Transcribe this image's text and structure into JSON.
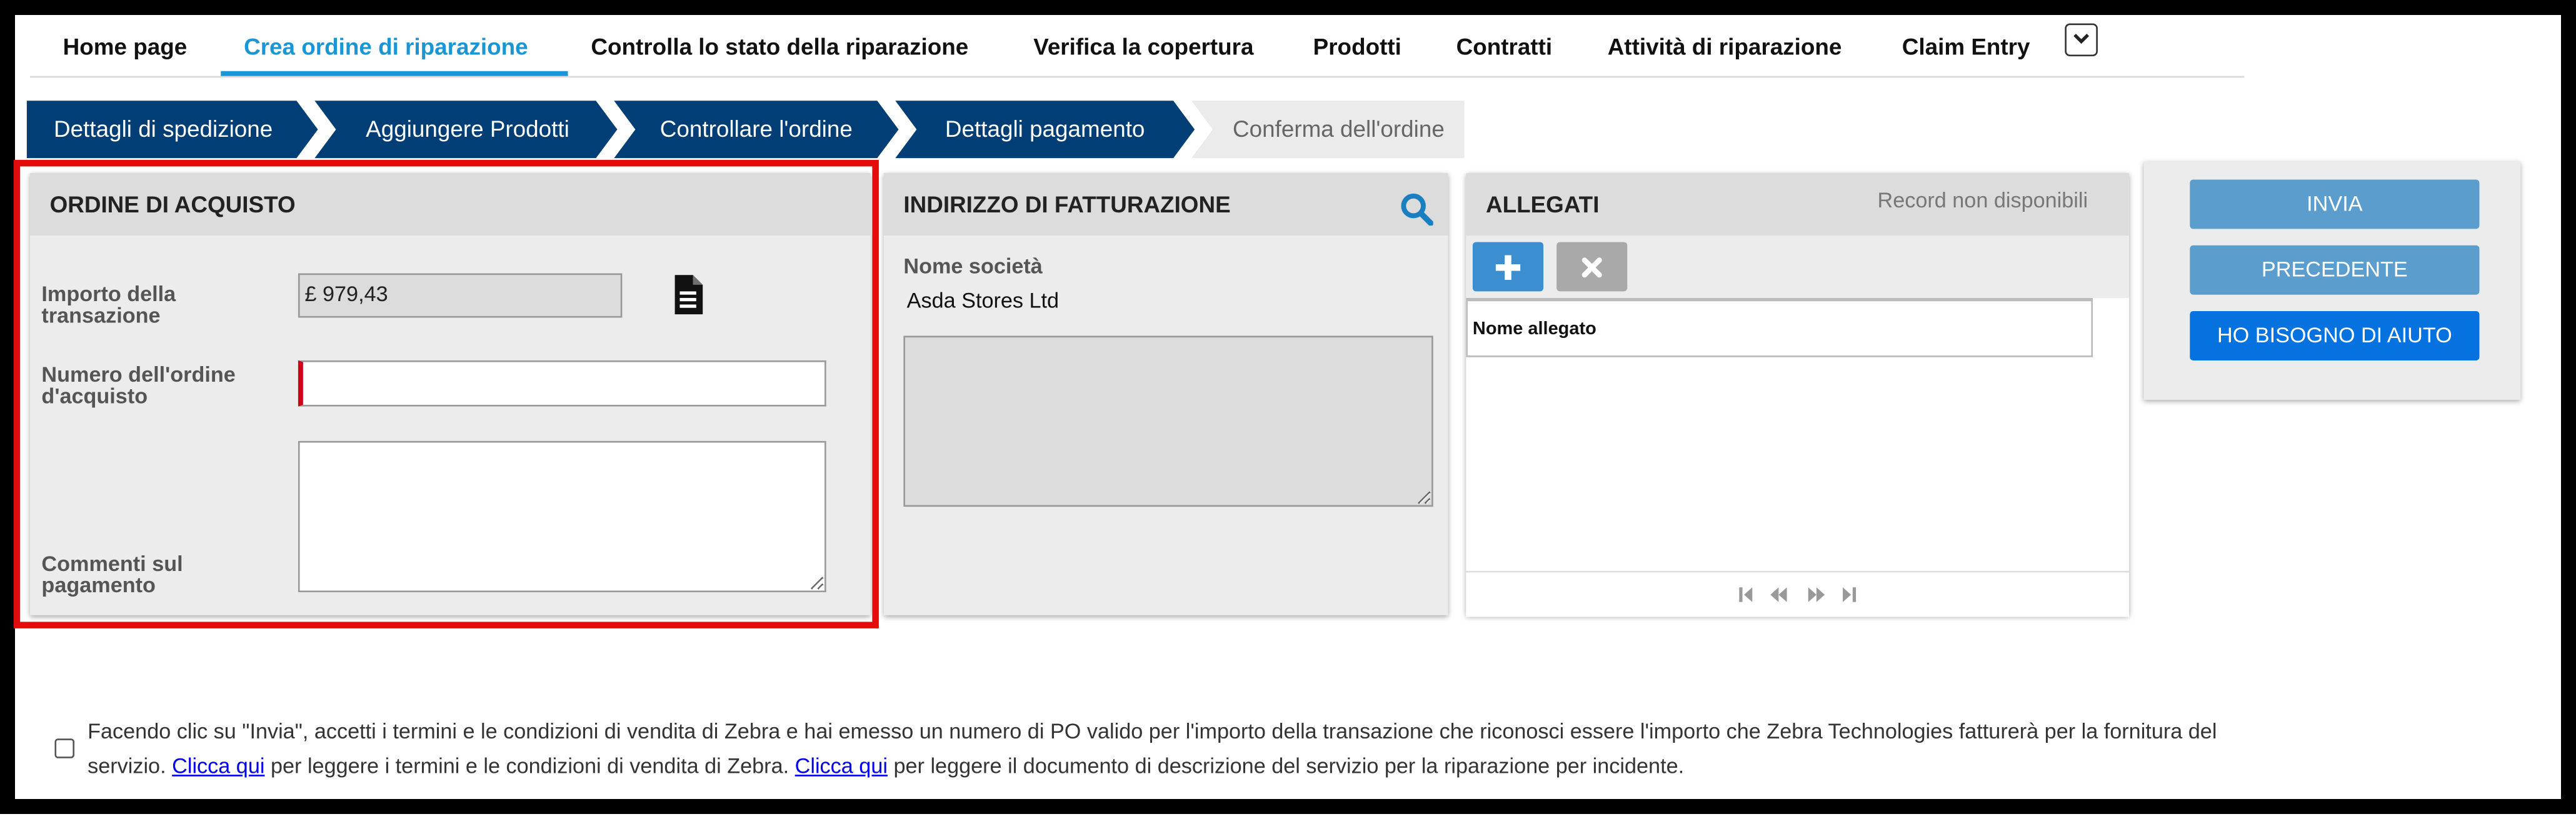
{
  "nav": {
    "items": [
      "Home page",
      "Crea ordine di riparazione",
      "Controlla lo stato della riparazione",
      "Verifica la copertura",
      "Prodotti",
      "Contratti",
      "Attività di riparazione",
      "Claim Entry"
    ],
    "active_index": 1,
    "more_icon": "chevron-down-icon"
  },
  "steps": {
    "items": [
      "Dettagli di spedizione",
      "Aggiungere Prodotti",
      "Controllare l'ordine",
      "Dettagli pagamento",
      "Conferma dell'ordine"
    ],
    "completed_color": "#003e75",
    "pending_color": "#ebebeb"
  },
  "purchase_order": {
    "title": "ORDINE DI ACQUISTO",
    "amount_label": "Importo della transazione",
    "amount_value": "£ 979,43",
    "amount_icon": "document-icon",
    "po_label": "Numero dell'ordine d'acquisto",
    "po_value": "",
    "comments_label": "Commenti sul pagamento",
    "comments_value": ""
  },
  "billing": {
    "title": "INDIRIZZO DI FATTURAZIONE",
    "search_icon": "search-icon",
    "company_label": "Nome società",
    "company_value": "Asda Stores Ltd",
    "address_value": ""
  },
  "attachments": {
    "title": "ALLEGATI",
    "status": "Record non disponibili",
    "add_icon": "plus-icon",
    "remove_icon": "close-icon",
    "column_header": "Nome allegato",
    "pager_icons": [
      "first-page-icon",
      "previous-page-icon",
      "next-page-icon",
      "last-page-icon"
    ]
  },
  "actions": {
    "submit": "INVIA",
    "previous": "PRECEDENTE",
    "help": "HO BISOGNO DI AIUTO",
    "secondary_color": "#5b9ecd",
    "primary_color": "#0672e0"
  },
  "terms": {
    "text_1": "Facendo clic su \"Invia\", accetti i termini e le condizioni di vendita di Zebra e hai emesso un numero di PO valido per l'importo della transazione che riconosci essere l'importo che Zebra Technologies fatturerà per la fornitura del servizio.",
    "link_1": "Clicca qui",
    "text_2": "per leggere i termini e le condizioni di vendita di Zebra.",
    "link_2": "Clicca qui",
    "text_3": "per leggere il documento di descrizione del servizio per la riparazione per incidente.",
    "checked": false
  },
  "highlight_color": "#e30b0b"
}
